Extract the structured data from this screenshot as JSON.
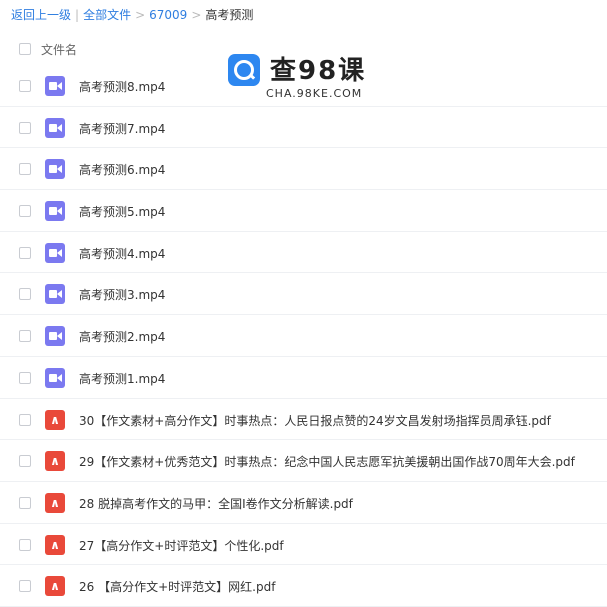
{
  "breadcrumb": {
    "back": "返回上一级",
    "all": "全部文件",
    "folder": "67009",
    "current": "高考预测",
    "sep": "|",
    "arrow": ">"
  },
  "header": {
    "name_col": "文件名"
  },
  "watermark": {
    "title": "查98课",
    "url": "CHA.98KE.COM"
  },
  "files": [
    {
      "name": "高考预测8.mp4",
      "type": "video"
    },
    {
      "name": "高考预测7.mp4",
      "type": "video"
    },
    {
      "name": "高考预测6.mp4",
      "type": "video"
    },
    {
      "name": "高考预测5.mp4",
      "type": "video"
    },
    {
      "name": "高考预测4.mp4",
      "type": "video"
    },
    {
      "name": "高考预测3.mp4",
      "type": "video"
    },
    {
      "name": "高考预测2.mp4",
      "type": "video"
    },
    {
      "name": "高考预测1.mp4",
      "type": "video"
    },
    {
      "name": "30【作文素材+高分作文】时事热点：人民日报点赞的24岁文昌发射场指挥员周承钰.pdf",
      "type": "pdf"
    },
    {
      "name": "29【作文素材+优秀范文】时事热点：纪念中国人民志愿军抗美援朝出国作战70周年大会.pdf",
      "type": "pdf"
    },
    {
      "name": "28 脱掉高考作文的马甲：全国I卷作文分析解读.pdf",
      "type": "pdf"
    },
    {
      "name": "27【高分作文+时评范文】个性化.pdf",
      "type": "pdf"
    },
    {
      "name": "26 【高分作文+时评范文】网红.pdf",
      "type": "pdf"
    }
  ],
  "colors": {
    "link": "#2f7ee0",
    "video_icon": "#7b79f0",
    "pdf_icon": "#e9493a",
    "logo": "#2d87f0"
  },
  "icons": {
    "video": "video-file-icon",
    "pdf": "pdf-file-icon"
  }
}
